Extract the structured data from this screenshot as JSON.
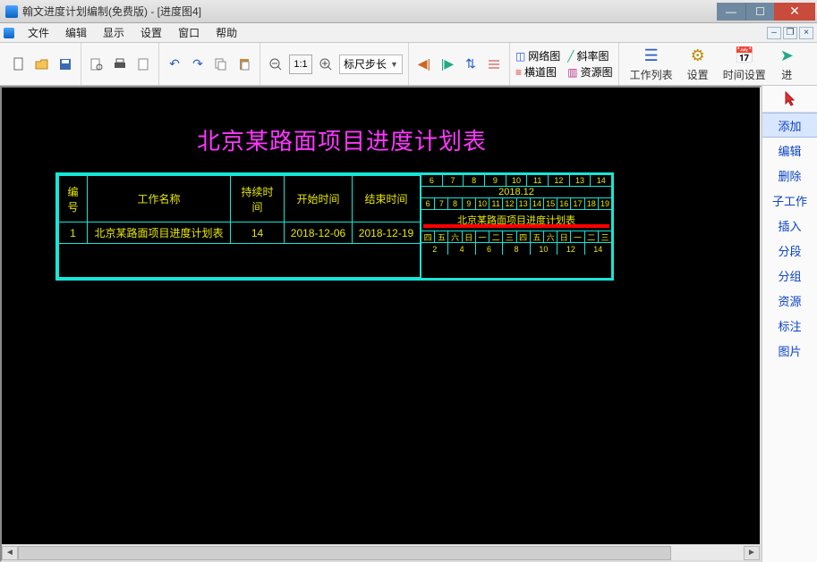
{
  "window": {
    "title": "翰文进度计划编制(免费版) - [进度图4]"
  },
  "menus": [
    "文件",
    "编辑",
    "显示",
    "设置",
    "窗口",
    "帮助"
  ],
  "toolbar": {
    "ruler_step": "标尺步长",
    "view": {
      "network": "网络图",
      "crossroad": "横道图",
      "slope": "斜率图",
      "resource": "资源图"
    },
    "big": {
      "worklist": "工作列表",
      "settings": "设置",
      "time_settings": "时间设置",
      "enter": "进"
    }
  },
  "side": {
    "items": [
      "添加",
      "编辑",
      "删除",
      "子工作",
      "插入",
      "分段",
      "分组",
      "资源",
      "标注",
      "图片"
    ],
    "active_index": 0
  },
  "chart": {
    "title": "北京某路面项目进度计划表",
    "headers": {
      "no": "编号",
      "name": "工作名称",
      "duration": "持续时间",
      "start": "开始时间",
      "end": "结束时间"
    },
    "rows": [
      {
        "no": "1",
        "name": "北京某路面项目进度计划表",
        "duration": "14",
        "start": "2018-12-06",
        "end": "2018-12-19",
        "bar_label": "北京某路面项目进度计划表"
      }
    ],
    "timeline": {
      "month_label": "2018.12",
      "top_days": [
        "6",
        "7",
        "8",
        "9",
        "10",
        "11",
        "12",
        "13",
        "14"
      ],
      "mid_days": [
        "6",
        "7",
        "8",
        "9",
        "10",
        "11",
        "12",
        "13",
        "14",
        "15",
        "16",
        "17",
        "18",
        "19"
      ],
      "weekdays": [
        "四",
        "五",
        "六",
        "日",
        "一",
        "二",
        "三",
        "四",
        "五",
        "六",
        "日",
        "一",
        "二",
        "三"
      ],
      "bottom_days": [
        "2",
        "4",
        "6",
        "8",
        "10",
        "12",
        "14"
      ]
    }
  }
}
